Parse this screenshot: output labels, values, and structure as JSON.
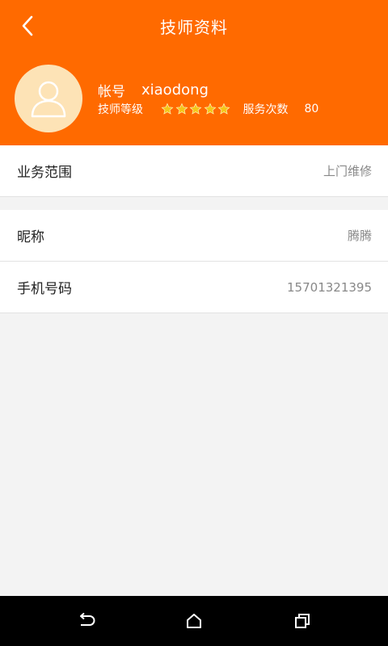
{
  "header": {
    "title": "技师资料",
    "account_label": "帐号",
    "account_value": "xiaodong",
    "level_label": "技师等级",
    "stars": 5,
    "service_label": "服务次数",
    "service_value": "80"
  },
  "rows": [
    {
      "label": "业务范围",
      "value": "上门维修"
    },
    {
      "label": "昵称",
      "value": "腾腾"
    },
    {
      "label": "手机号码",
      "value": "15701321395"
    }
  ],
  "colors": {
    "accent": "#ff6a00",
    "avatar_bg": "#fde3b6",
    "star": "#f5c518"
  },
  "icons": {
    "back": "back-chevron-icon",
    "avatar": "user-avatar-icon",
    "nav_back": "nav-back-icon",
    "nav_home": "nav-home-icon",
    "nav_recent": "nav-recent-apps-icon"
  }
}
